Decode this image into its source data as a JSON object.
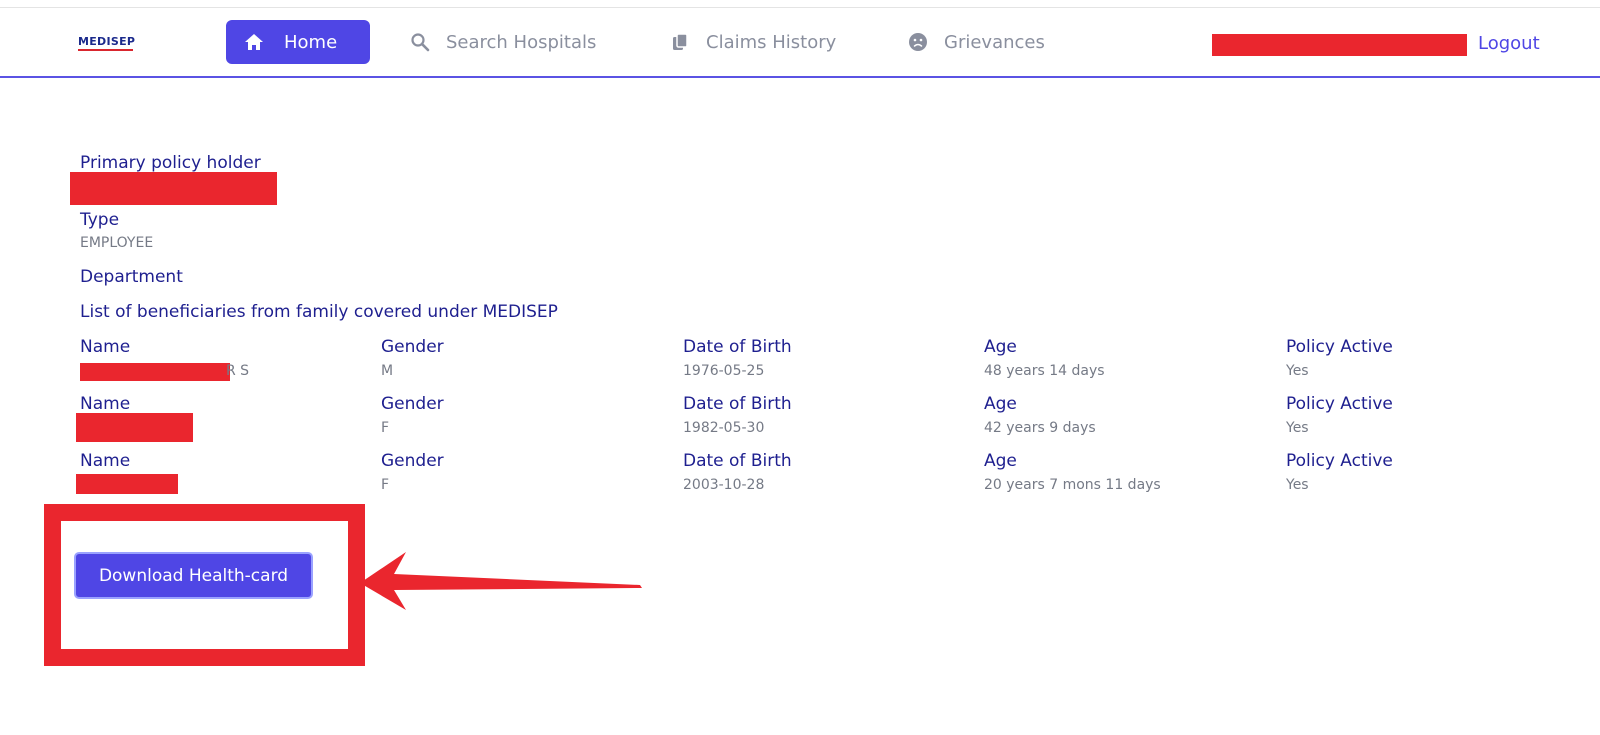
{
  "brand": {
    "logo_text": "MEDISEP"
  },
  "nav": {
    "home": "Home",
    "search": "Search Hospitals",
    "claims": "Claims History",
    "grievances": "Grievances",
    "logout": "Logout"
  },
  "policy": {
    "holder_label": "Primary policy holder",
    "type_label": "Type",
    "type_value": "EMPLOYEE",
    "department_label": "Department",
    "beneficiaries_heading": "List of beneficiaries from family covered under MEDISEP"
  },
  "columns": {
    "name": "Name",
    "gender": "Gender",
    "dob": "Date of Birth",
    "age": "Age",
    "active": "Policy Active"
  },
  "beneficiaries": [
    {
      "name_suffix": "R S",
      "gender": "M",
      "dob": "1976-05-25",
      "age": "48 years 14 days",
      "active": "Yes"
    },
    {
      "name_suffix": "",
      "gender": "F",
      "dob": "1982-05-30",
      "age": "42 years 9 days",
      "active": "Yes"
    },
    {
      "name_suffix": "",
      "gender": "F",
      "dob": "2003-10-28",
      "age": "20 years 7 mons 11 days",
      "active": "Yes"
    }
  ],
  "actions": {
    "download_label": "Download Health-card"
  },
  "colors": {
    "accent": "#4f46e5",
    "label": "#1e1f8f",
    "redaction": "#ea262e"
  }
}
